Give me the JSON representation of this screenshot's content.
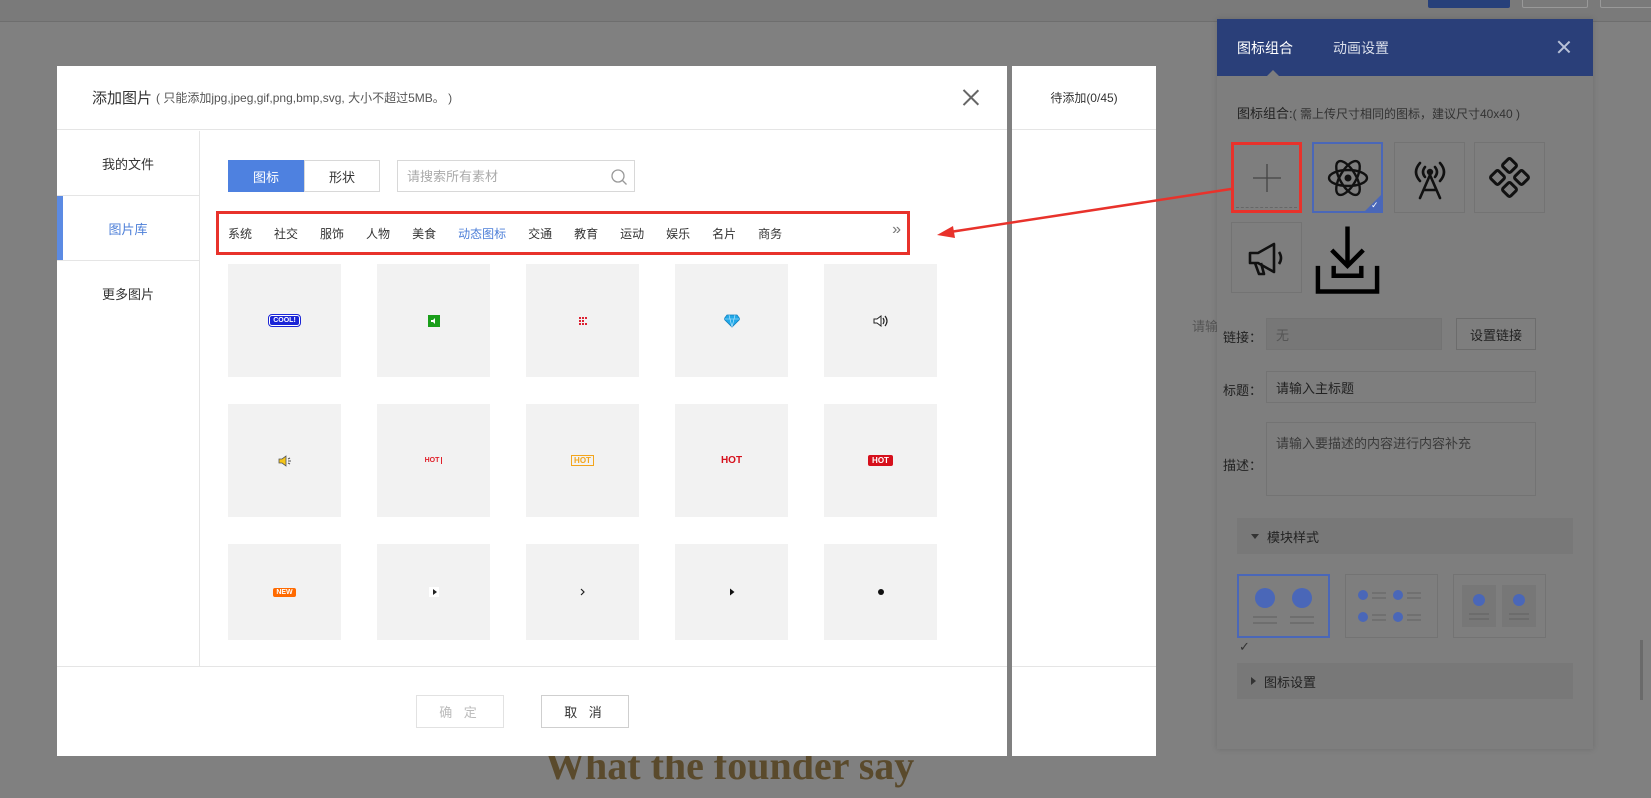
{
  "background": {
    "founder_heading": "What the founder say",
    "hint_text": "请输入"
  },
  "modal": {
    "title": "添加图片",
    "subtitle": "( 只能添加jpg,jpeg,gif,png,bmp,svg, 大小不超过5MB。 )",
    "sidebar": [
      {
        "label": "我的文件"
      },
      {
        "label": "图片库"
      },
      {
        "label": "更多图片"
      }
    ],
    "segment": {
      "icon_label": "图标",
      "shape_label": "形状"
    },
    "search": {
      "placeholder": "请搜索所有素材"
    },
    "categories": [
      "系统",
      "社交",
      "服饰",
      "人物",
      "美食",
      "动态图标",
      "交通",
      "教育",
      "运动",
      "娱乐",
      "名片",
      "商务"
    ],
    "active_category": "动态图标",
    "more_icon": "double-chevron-right-icon",
    "tiles": [
      {
        "icon": "cool-badge-icon",
        "text": "COOL!"
      },
      {
        "icon": "green-speaker-icon",
        "text": ""
      },
      {
        "icon": "dot-matrix-icon",
        "text": ""
      },
      {
        "icon": "diamond-icon",
        "text": ""
      },
      {
        "icon": "speaker-icon",
        "text": ""
      },
      {
        "icon": "yellow-speaker-icon",
        "text": ""
      },
      {
        "icon": "hot-red-thin-icon",
        "text": "HOT"
      },
      {
        "icon": "hot-orange-icon",
        "text": "HOT"
      },
      {
        "icon": "hot-red-bold-icon",
        "text": "HOT"
      },
      {
        "icon": "hot-red-badge-icon",
        "text": "HOT"
      },
      {
        "icon": "new-bubble-icon",
        "text": "NEW"
      },
      {
        "icon": "play-white-icon",
        "text": ""
      },
      {
        "icon": "chevron-right-icon",
        "text": ""
      },
      {
        "icon": "triangle-right-icon",
        "text": ""
      },
      {
        "icon": "dot-icon",
        "text": ""
      }
    ],
    "ok_label": "确 定",
    "cancel_label": "取 消"
  },
  "pending": {
    "label": "待添加(0/45)"
  },
  "panel": {
    "tabs": [
      "图标组合",
      "动画设置"
    ],
    "group_label": "图标组合:",
    "group_hint": "( 需上传尺寸相同的图标，建议尺寸40x40 )",
    "icons": [
      "add-icon",
      "atom-icon",
      "broadcast-tower-icon",
      "network-nodes-icon",
      "megaphone-icon",
      "download-icon"
    ],
    "link_label": "链接：",
    "link_value": "无",
    "set_link_label": "设置链接",
    "title_label": "标题：",
    "title_value": "请输入主标题",
    "desc_label": "描述：",
    "desc_placeholder": "请输入要描述的内容进行内容补充",
    "module_style_label": "模块样式",
    "icon_settings_label": "图标设置",
    "accent_color": "#4a67b8"
  },
  "colors": {
    "primary": "#4e81e0",
    "highlight": "#e8322b",
    "panel_header": "#2a3f79"
  }
}
